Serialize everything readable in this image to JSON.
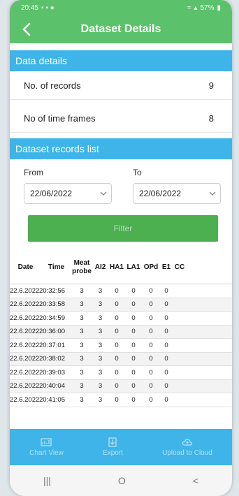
{
  "status_bar": {
    "time": "20:45",
    "battery": "57%"
  },
  "appbar": {
    "title": "Dataset Details"
  },
  "data_details": {
    "header": "Data details",
    "records_label": "No. of records",
    "records_value": "9",
    "frames_label": "No of time frames",
    "frames_value": "8"
  },
  "records_list": {
    "header": "Dataset records list",
    "from_label": "From",
    "to_label": "To",
    "from_value": "22/06/2022",
    "to_value": "22/06/2022",
    "filter_label": "Filter"
  },
  "table": {
    "columns": [
      "Date",
      "Time",
      "Meat probe",
      "AI2",
      "HA1",
      "LA1",
      "OPd",
      "E1",
      "CC"
    ],
    "rows": [
      [
        "22.6.2022",
        "20:32:56",
        "3",
        "3",
        "0",
        "0",
        "0",
        "0"
      ],
      [
        "22.6.2022",
        "20:33:58",
        "3",
        "3",
        "0",
        "0",
        "0",
        "0"
      ],
      [
        "22.6.2022",
        "20:34:59",
        "3",
        "3",
        "0",
        "0",
        "0",
        "0"
      ],
      [
        "22.6.2022",
        "20:36:00",
        "3",
        "3",
        "0",
        "0",
        "0",
        "0"
      ],
      [
        "22.6.2022",
        "20:37:01",
        "3",
        "3",
        "0",
        "0",
        "0",
        "0"
      ],
      [
        "22.6.2022",
        "20:38:02",
        "3",
        "3",
        "0",
        "0",
        "0",
        "0"
      ],
      [
        "22.6.2022",
        "20:39:03",
        "3",
        "3",
        "0",
        "0",
        "0",
        "0"
      ],
      [
        "22.6.2022",
        "20:40:04",
        "3",
        "3",
        "0",
        "0",
        "0",
        "0"
      ],
      [
        "22.6.2022",
        "20:41:05",
        "3",
        "3",
        "0",
        "0",
        "0",
        "0"
      ]
    ]
  },
  "bottom_nav": {
    "chart_view": "Chart View",
    "export": "Export",
    "upload": "Upload to Cloud"
  },
  "system_nav": {
    "recents": "|||",
    "home": "O",
    "back": "<"
  }
}
